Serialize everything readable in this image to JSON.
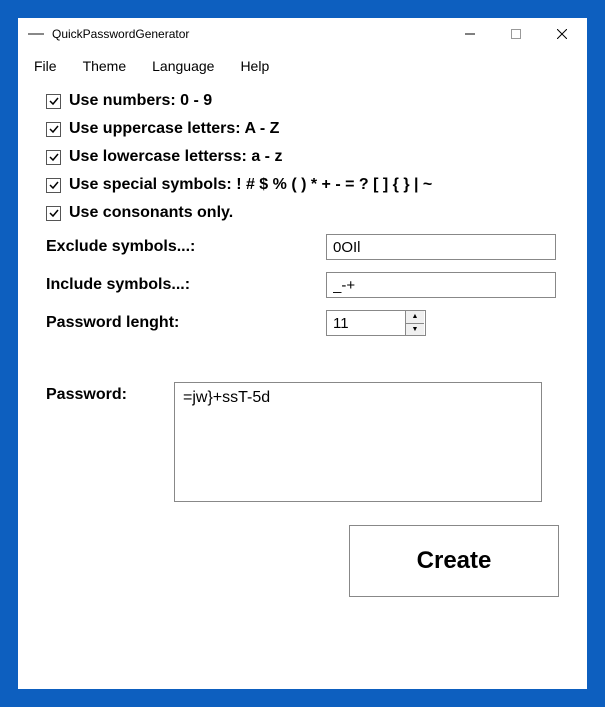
{
  "window": {
    "title": "QuickPasswordGenerator"
  },
  "menu": {
    "file": "File",
    "theme": "Theme",
    "language": "Language",
    "help": "Help"
  },
  "options": {
    "numbers": "Use numbers: 0 - 9",
    "uppercase": "Use uppercase letters: A - Z",
    "lowercase": "Use lowercase letterss: a - z",
    "special": "Use special symbols: ! # $ % ( ) * + - = ? [ ] { } | ~",
    "consonants": "Use consonants only."
  },
  "fields": {
    "exclude_label": "Exclude symbols...:",
    "exclude_value": "0OIl",
    "include_label": "Include symbols...:",
    "include_value": "_-+",
    "length_label": "Password lenght:",
    "length_value": "11"
  },
  "password": {
    "label": "Password:",
    "value": "=jw}+ssT-5d"
  },
  "buttons": {
    "create": "Create"
  }
}
